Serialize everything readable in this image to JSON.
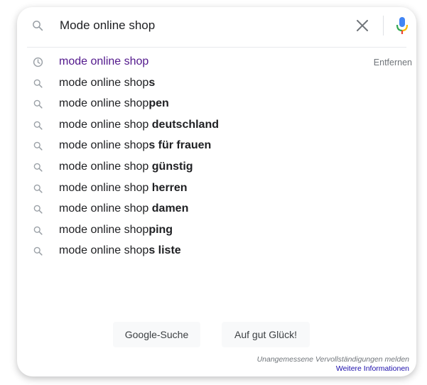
{
  "search": {
    "query": "Mode online shop",
    "clear_label": "×"
  },
  "icons": {
    "search": "magnifier-icon",
    "history": "clock-icon",
    "clear": "close-icon",
    "voice": "microphone-icon"
  },
  "colors": {
    "history_text": "#52188c",
    "link": "#1a0dab",
    "mic_blue": "#4285f4",
    "mic_red": "#ea4335",
    "mic_yellow": "#fbbc04",
    "mic_green": "#34a853"
  },
  "suggestions": [
    {
      "type": "history",
      "base": "mode online shop",
      "suffix": "",
      "action": "Entfernen"
    },
    {
      "type": "search",
      "base": "mode online shop",
      "suffix": "s"
    },
    {
      "type": "search",
      "base": "mode online shop",
      "suffix": "pen"
    },
    {
      "type": "search",
      "base": "mode online shop ",
      "suffix": "deutschland"
    },
    {
      "type": "search",
      "base": "mode online shop",
      "suffix": "s für frauen"
    },
    {
      "type": "search",
      "base": "mode online shop ",
      "suffix": "günstig"
    },
    {
      "type": "search",
      "base": "mode online shop ",
      "suffix": "herren"
    },
    {
      "type": "search",
      "base": "mode online shop ",
      "suffix": "damen"
    },
    {
      "type": "search",
      "base": "mode online shop",
      "suffix": "ping"
    },
    {
      "type": "search",
      "base": "mode online shop",
      "suffix": "s liste"
    }
  ],
  "buttons": {
    "search_label": "Google-Suche",
    "lucky_label": "Auf gut Glück!"
  },
  "footer": {
    "report_label": "Unangemessene Vervollständigungen melden",
    "more_label": "Weitere Informationen"
  }
}
